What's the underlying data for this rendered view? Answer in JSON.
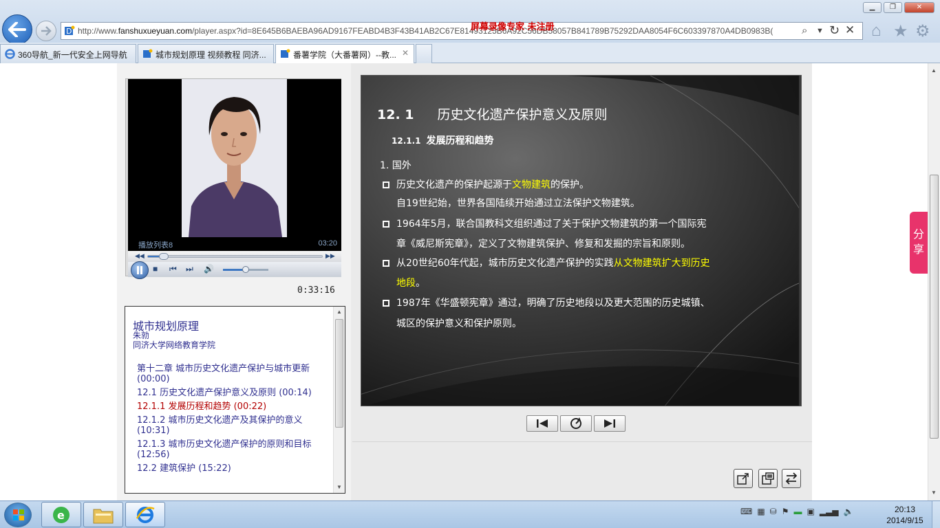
{
  "browser": {
    "url_prefix": "http://www.",
    "url_domain": "fanshuxueyuan.com",
    "url_rest": "/player.aspx?id=8E645B6BAEBA96AD9167FEABD4B3F43B41AB2C67E81493125B6A92C56DB58057B841789B75292DAA8054F6C603397870A4DB0983B(",
    "watermark_text": "屏幕录像专家  未注册"
  },
  "tabs": [
    {
      "label": "360导航_新一代安全上网导航",
      "active": false
    },
    {
      "label": "城市规划原理 视频教程 同济...",
      "active": false
    },
    {
      "label": "番薯学院（大番薯网）--教...",
      "active": true
    }
  ],
  "player": {
    "playlist_label": "播放列表8",
    "video_time": "03:20",
    "elapsed": "0:33:16",
    "seek_progress": 0.08,
    "volume_level": 0.5
  },
  "toc": {
    "course_title": "城市规划原理",
    "teacher": "朱勍",
    "school": "同济大学网络教育学院",
    "items": [
      {
        "label": "第十二章 城市历史文化遗产保护与城市更新 (00:00)",
        "current": false
      },
      {
        "label": "12.1 历史文化遗产保护意义及原则 (00:14)",
        "current": false
      },
      {
        "label": "12.1.1 发展历程和趋势 (00:22)",
        "current": true
      },
      {
        "label": "12.1.2 城市历史文化遗产及其保护的意义 (10:31)",
        "current": false
      },
      {
        "label": "12.1.3 城市历史文化遗产保护的原则和目标 (12:56)",
        "current": false
      },
      {
        "label": "12.2 建筑保护 (15:22)",
        "current": false
      }
    ]
  },
  "slide": {
    "title_num": "12. 1",
    "title_text": "历史文化遗产保护意义及原则",
    "sub_num": "12.1.1",
    "sub_text": "发展历程和趋势",
    "country": "1. 国外",
    "b1_l1_pre": "历史文化遗产的保护起源于",
    "b1_l1_hl": "文物建筑",
    "b1_l1_post": "的保护。",
    "b1_l2": "自19世纪始，世界各国陆续开始通过立法保护文物建筑。",
    "b2_l1": "1964年5月，联合国教科文组织通过了关于保护文物建筑的第一个国际宪",
    "b2_l2": "章《威尼斯宪章》，定义了文物建筑保护、修复和发掘的宗旨和原则。",
    "b3_l1_pre": "从20世纪60年代起，城市历史文化遗产保护的实践",
    "b3_l1_hl": "从文物建筑扩大到历史",
    "b3_l2_hl": "地段",
    "b3_l2_post": "。",
    "b4_l1": "1987年《华盛顿宪章》通过，明确了历史地段以及更大范围的历史城镇、",
    "b4_l2": "城区的保护意义和保护原则。"
  },
  "share": {
    "label_1": "分",
    "label_2": "享"
  },
  "clock": {
    "time": "20:13",
    "date": "2014/9/15"
  }
}
